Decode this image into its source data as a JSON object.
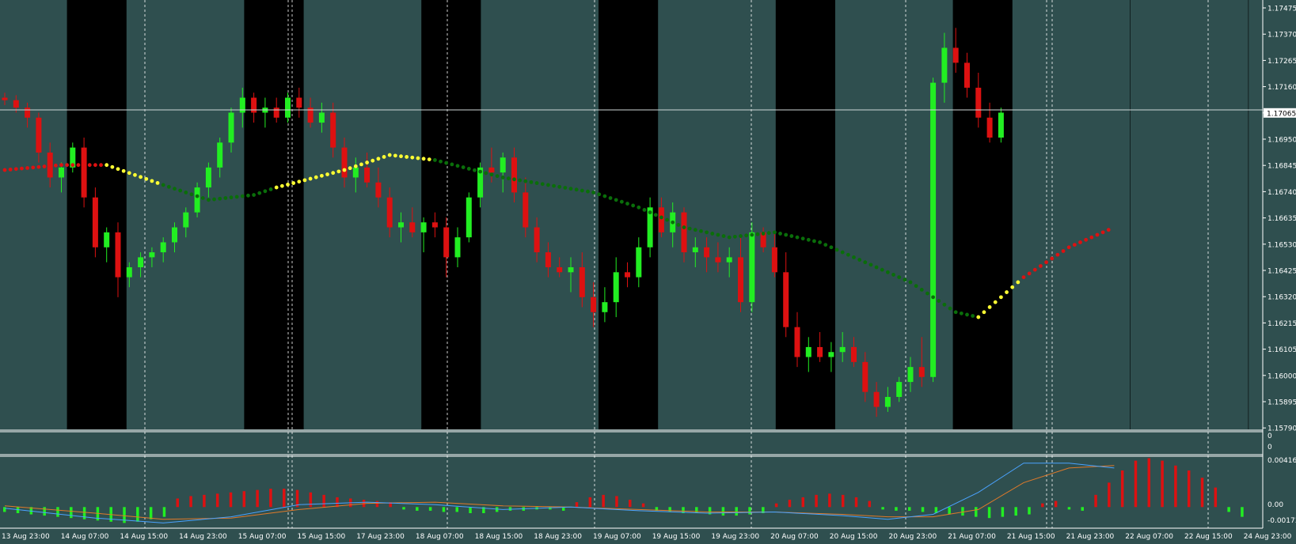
{
  "colors": {
    "background": "#2f4f4f",
    "session_band": "#000000",
    "bull_candle": "#22ee22",
    "bear_candle": "#dd1111",
    "ma_trend_down": "#0a6e0a",
    "ma_trend_up": "#ffff33",
    "ma_red": "#dd1111",
    "grid_text": "#ffffff",
    "macd_hist_up": "#dd1111",
    "macd_hist_down": "#22ee22",
    "macd_line": "#4aa3ff",
    "signal_line": "#e07a2a"
  },
  "chart_data": [
    {
      "type": "candlestick",
      "pane": "price",
      "current_price_label": "1.17065",
      "y_ticks": [
        "1.17475",
        "1.17370",
        "1.17265",
        "1.17160",
        "1.17065",
        "1.16950",
        "1.16845",
        "1.16740",
        "1.16635",
        "1.16530",
        "1.16425",
        "1.16320",
        "1.16215",
        "1.16105",
        "1.16000",
        "1.15895",
        "1.15790"
      ],
      "ylim": [
        1.1579,
        1.1748
      ],
      "x_labels": [
        "13 Aug 23:00",
        "14 Aug 07:00",
        "14 Aug 15:00",
        "14 Aug 23:00",
        "15 Aug 07:00",
        "15 Aug 15:00",
        "17 Aug 23:00",
        "18 Aug 07:00",
        "18 Aug 15:00",
        "18 Aug 23:00",
        "19 Aug 07:00",
        "19 Aug 15:00",
        "19 Aug 23:00",
        "20 Aug 07:00",
        "20 Aug 15:00",
        "20 Aug 23:00",
        "21 Aug 07:00",
        "21 Aug 15:00",
        "21 Aug 23:00",
        "22 Aug 07:00",
        "22 Aug 15:00",
        "24 Aug 23:00"
      ],
      "session_bands": [
        [
          1,
          3
        ],
        [
          4,
          6
        ],
        [
          7,
          9
        ],
        [
          10,
          12
        ],
        [
          13,
          15
        ],
        [
          16,
          18
        ],
        [
          19,
          20
        ],
        [
          21,
          22
        ]
      ],
      "candles": [
        [
          1.1712,
          1.1714,
          1.1709,
          1.1711
        ],
        [
          1.1711,
          1.1713,
          1.1706,
          1.1708
        ],
        [
          1.1708,
          1.171,
          1.17,
          1.1704
        ],
        [
          1.1704,
          1.1706,
          1.1686,
          1.169
        ],
        [
          1.169,
          1.1694,
          1.1676,
          1.168
        ],
        [
          1.168,
          1.1686,
          1.1674,
          1.1684
        ],
        [
          1.1684,
          1.1694,
          1.1682,
          1.1692
        ],
        [
          1.1692,
          1.1696,
          1.1668,
          1.1672
        ],
        [
          1.1672,
          1.1676,
          1.1648,
          1.1652
        ],
        [
          1.1652,
          1.166,
          1.1646,
          1.1658
        ],
        [
          1.1658,
          1.1662,
          1.1632,
          1.164
        ],
        [
          1.164,
          1.1646,
          1.1636,
          1.1644
        ],
        [
          1.1644,
          1.165,
          1.164,
          1.1648
        ],
        [
          1.1648,
          1.1652,
          1.1644,
          1.165
        ],
        [
          1.165,
          1.1656,
          1.1646,
          1.1654
        ],
        [
          1.1654,
          1.1662,
          1.165,
          1.166
        ],
        [
          1.166,
          1.1668,
          1.1656,
          1.1666
        ],
        [
          1.1666,
          1.1678,
          1.1664,
          1.1676
        ],
        [
          1.1676,
          1.1686,
          1.1672,
          1.1684
        ],
        [
          1.1684,
          1.1696,
          1.168,
          1.1694
        ],
        [
          1.1694,
          1.1708,
          1.169,
          1.1706
        ],
        [
          1.1706,
          1.1716,
          1.17,
          1.1712
        ],
        [
          1.1712,
          1.1714,
          1.1702,
          1.1706
        ],
        [
          1.1706,
          1.1712,
          1.17,
          1.1708
        ],
        [
          1.1708,
          1.1712,
          1.1702,
          1.1704
        ],
        [
          1.1704,
          1.1714,
          1.1702,
          1.1712
        ],
        [
          1.1712,
          1.1716,
          1.1704,
          1.1708
        ],
        [
          1.1708,
          1.1712,
          1.17,
          1.1702
        ],
        [
          1.1702,
          1.171,
          1.1698,
          1.1706
        ],
        [
          1.1706,
          1.171,
          1.1688,
          1.1692
        ],
        [
          1.1692,
          1.1696,
          1.1676,
          1.168
        ],
        [
          1.168,
          1.1688,
          1.1674,
          1.1684
        ],
        [
          1.1684,
          1.169,
          1.1676,
          1.1678
        ],
        [
          1.1678,
          1.1684,
          1.1668,
          1.1672
        ],
        [
          1.1672,
          1.1676,
          1.1656,
          1.166
        ],
        [
          1.166,
          1.1666,
          1.1654,
          1.1662
        ],
        [
          1.1662,
          1.1668,
          1.1656,
          1.1658
        ],
        [
          1.1658,
          1.1664,
          1.165,
          1.1662
        ],
        [
          1.1662,
          1.1666,
          1.1656,
          1.166
        ],
        [
          1.166,
          1.1664,
          1.164,
          1.1648
        ],
        [
          1.1648,
          1.166,
          1.1644,
          1.1656
        ],
        [
          1.1656,
          1.1674,
          1.1654,
          1.1672
        ],
        [
          1.1672,
          1.1686,
          1.1668,
          1.1684
        ],
        [
          1.1684,
          1.1692,
          1.1678,
          1.1682
        ],
        [
          1.1682,
          1.169,
          1.1674,
          1.1688
        ],
        [
          1.1688,
          1.1692,
          1.167,
          1.1674
        ],
        [
          1.1674,
          1.168,
          1.1656,
          1.166
        ],
        [
          1.166,
          1.1664,
          1.1646,
          1.165
        ],
        [
          1.165,
          1.1654,
          1.164,
          1.1644
        ],
        [
          1.1644,
          1.1648,
          1.164,
          1.1642
        ],
        [
          1.1642,
          1.1648,
          1.1634,
          1.1644
        ],
        [
          1.1644,
          1.165,
          1.1628,
          1.1632
        ],
        [
          1.1632,
          1.1638,
          1.162,
          1.1626
        ],
        [
          1.1626,
          1.1636,
          1.1622,
          1.163
        ],
        [
          1.163,
          1.1648,
          1.1624,
          1.1642
        ],
        [
          1.1642,
          1.1646,
          1.1636,
          1.164
        ],
        [
          1.164,
          1.1656,
          1.1636,
          1.1652
        ],
        [
          1.1652,
          1.1672,
          1.1648,
          1.1668
        ],
        [
          1.1668,
          1.1672,
          1.1656,
          1.1658
        ],
        [
          1.1658,
          1.167,
          1.1652,
          1.1666
        ],
        [
          1.1666,
          1.1668,
          1.1646,
          1.165
        ],
        [
          1.165,
          1.1656,
          1.1644,
          1.1652
        ],
        [
          1.1652,
          1.1656,
          1.1642,
          1.1648
        ],
        [
          1.1648,
          1.1654,
          1.1642,
          1.1646
        ],
        [
          1.1646,
          1.1652,
          1.164,
          1.1648
        ],
        [
          1.1648,
          1.1656,
          1.1626,
          1.163
        ],
        [
          1.163,
          1.1662,
          1.1626,
          1.1658
        ],
        [
          1.1658,
          1.166,
          1.165,
          1.1652
        ],
        [
          1.1652,
          1.1658,
          1.164,
          1.1642
        ],
        [
          1.1642,
          1.165,
          1.1616,
          1.162
        ],
        [
          1.162,
          1.1626,
          1.1604,
          1.1608
        ],
        [
          1.1608,
          1.1616,
          1.1602,
          1.1612
        ],
        [
          1.1612,
          1.1618,
          1.1606,
          1.1608
        ],
        [
          1.1608,
          1.1614,
          1.1602,
          1.161
        ],
        [
          1.161,
          1.1618,
          1.1606,
          1.1612
        ],
        [
          1.1612,
          1.1616,
          1.1604,
          1.1606
        ],
        [
          1.1606,
          1.161,
          1.159,
          1.1594
        ],
        [
          1.1594,
          1.1598,
          1.1584,
          1.1588
        ],
        [
          1.1588,
          1.1596,
          1.1586,
          1.1592
        ],
        [
          1.1592,
          1.16,
          1.159,
          1.1598
        ],
        [
          1.1598,
          1.1608,
          1.1594,
          1.1604
        ],
        [
          1.1604,
          1.1616,
          1.1596,
          1.16
        ],
        [
          1.16,
          1.172,
          1.1598,
          1.1718
        ],
        [
          1.1718,
          1.1738,
          1.171,
          1.1732
        ],
        [
          1.1732,
          1.174,
          1.1722,
          1.1726
        ],
        [
          1.1726,
          1.173,
          1.1712,
          1.1716
        ],
        [
          1.1716,
          1.1722,
          1.17,
          1.1704
        ],
        [
          1.1704,
          1.171,
          1.1694,
          1.1696
        ],
        [
          1.1696,
          1.1708,
          1.1694,
          1.1706
        ]
      ],
      "ma_line": [
        [
          0,
          1.1683,
          "red"
        ],
        [
          5,
          1.1685,
          "red"
        ],
        [
          9,
          1.1685,
          "yellow"
        ],
        [
          14,
          1.1677,
          "green"
        ],
        [
          18,
          1.1671,
          "green"
        ],
        [
          22,
          1.1673,
          "green"
        ],
        [
          24,
          1.1676,
          "yellow"
        ],
        [
          30,
          1.1683,
          "yellow"
        ],
        [
          34,
          1.1689,
          "yellow"
        ],
        [
          38,
          1.1687,
          "green"
        ],
        [
          44,
          1.168,
          "green"
        ],
        [
          48,
          1.1677,
          "green"
        ],
        [
          52,
          1.1674,
          "green"
        ],
        [
          56,
          1.1668,
          "green"
        ],
        [
          60,
          1.166,
          "green"
        ],
        [
          64,
          1.1656,
          "green"
        ],
        [
          68,
          1.1658,
          "green"
        ],
        [
          72,
          1.1654,
          "green"
        ],
        [
          76,
          1.1646,
          "green"
        ],
        [
          80,
          1.1638,
          "green"
        ],
        [
          84,
          1.1626,
          "green"
        ],
        [
          86,
          1.1624,
          "yellow"
        ],
        [
          88,
          1.1632,
          "yellow"
        ],
        [
          90,
          1.164,
          "red"
        ],
        [
          94,
          1.1652,
          "red"
        ],
        [
          98,
          1.166,
          "red"
        ]
      ]
    },
    {
      "type": "bar",
      "pane": "oscillator",
      "y_ticks": [
        "0",
        "0"
      ]
    },
    {
      "type": "macd",
      "pane": "macd",
      "y_ticks": [
        "0.004162",
        "0.00",
        "-0.00173"
      ],
      "ylim": [
        -0.00173,
        0.004162
      ],
      "histogram": [
        -0.0004,
        -0.0005,
        -0.0006,
        -0.0007,
        -0.0008,
        -0.0009,
        -0.001,
        -0.0011,
        -0.0012,
        -0.0013,
        -0.0012,
        -0.001,
        -0.0008,
        0.0007,
        0.0009,
        0.001,
        0.0011,
        0.0012,
        0.0013,
        0.0014,
        0.0015,
        0.0015,
        0.0014,
        0.0012,
        0.001,
        0.0008,
        0.0007,
        0.0006,
        0.0005,
        0.0004,
        -0.0002,
        -0.0003,
        -0.0003,
        -0.0004,
        -0.0004,
        -0.0005,
        -0.0005,
        -0.0004,
        -0.0003,
        -0.0003,
        -0.0002,
        -0.0002,
        -0.0003,
        0.0004,
        0.0008,
        0.001,
        0.0009,
        0.0006,
        0.0003,
        -0.0003,
        -0.0004,
        -0.0005,
        -0.0005,
        -0.0006,
        -0.0007,
        -0.0007,
        -0.0006,
        -0.0005,
        0.0003,
        0.0006,
        0.0008,
        0.001,
        0.0011,
        0.001,
        0.0008,
        0.0005,
        -0.0002,
        -0.0003,
        -0.0003,
        -0.0004,
        -0.0005,
        -0.0006,
        -0.0007,
        -0.0008,
        -0.0009,
        -0.0008,
        -0.0007,
        -0.0006,
        0.0003,
        0.0005,
        -0.0002,
        -0.0003,
        0.001,
        0.002,
        0.003,
        0.0038,
        0.004,
        0.0038,
        0.0034,
        0.003,
        0.0024,
        0.0016,
        -0.0004,
        -0.0008
      ],
      "macd_line": [
        [
          0,
          -0.0001
        ],
        [
          8,
          -0.0009
        ],
        [
          14,
          -0.0013
        ],
        [
          20,
          -0.0008
        ],
        [
          26,
          0.0002
        ],
        [
          32,
          0.0004
        ],
        [
          38,
          0.0002
        ],
        [
          44,
          -0.0002
        ],
        [
          50,
          0.0
        ],
        [
          56,
          -0.0003
        ],
        [
          62,
          -0.0005
        ],
        [
          68,
          -0.0004
        ],
        [
          74,
          -0.0007
        ],
        [
          78,
          -0.001
        ],
        [
          82,
          -0.0006
        ],
        [
          86,
          0.0012
        ],
        [
          90,
          0.0036
        ],
        [
          94,
          0.0036
        ],
        [
          98,
          0.0032
        ]
      ],
      "signal_line": [
        [
          0,
          0.0001
        ],
        [
          8,
          -0.0005
        ],
        [
          14,
          -0.001
        ],
        [
          20,
          -0.0009
        ],
        [
          26,
          -0.0002
        ],
        [
          32,
          0.0003
        ],
        [
          38,
          0.0004
        ],
        [
          44,
          0.0001
        ],
        [
          50,
          0.0
        ],
        [
          56,
          -0.0002
        ],
        [
          62,
          -0.0004
        ],
        [
          68,
          -0.0004
        ],
        [
          74,
          -0.0006
        ],
        [
          78,
          -0.0008
        ],
        [
          82,
          -0.0008
        ],
        [
          86,
          -0.0002
        ],
        [
          90,
          0.002
        ],
        [
          94,
          0.0032
        ],
        [
          98,
          0.0034
        ]
      ]
    }
  ]
}
